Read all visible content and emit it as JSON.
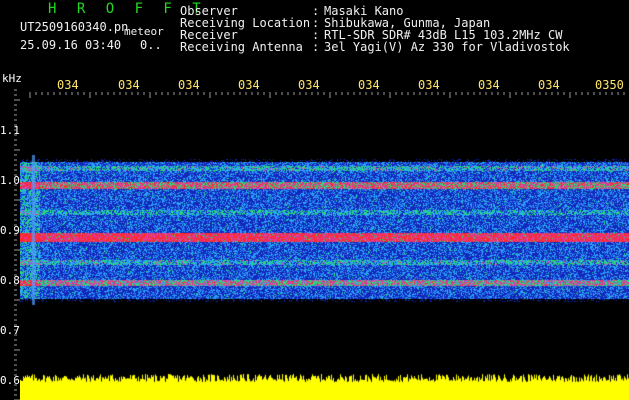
{
  "header": {
    "title": "H R O F F T",
    "filename": "UT2509160340.pn",
    "mode": "meteor",
    "datetime": "25.09.16 03:40",
    "extra": "0..",
    "meta": [
      {
        "key": "Observer",
        "value": "Masaki Kano"
      },
      {
        "key": "Receiving Location",
        "value": "Shibukawa, Gunma, Japan"
      },
      {
        "key": "Receiver",
        "value": "RTL-SDR SDR# 43dB L15 103.2MHz CW"
      },
      {
        "key": "Receiving Antenna",
        "value": "3el Yagi(V) Az 330 for Vladivostok"
      }
    ]
  },
  "axis": {
    "unit": "kHz",
    "y_labels": [
      "1.1",
      "1.0",
      "0.9",
      "0.8",
      "0.7",
      "0.6"
    ],
    "time_labels": [
      "034",
      "034",
      "034",
      "034",
      "034",
      "034",
      "034",
      "034",
      "034",
      "0350"
    ]
  },
  "colors": {
    "title_green": "#24d824",
    "time_yellow": "#ffe66a",
    "background": "#000000",
    "noise_blue": "#1a2a9a",
    "signal_red": "#ff2828",
    "power_yellow": "#ffff00"
  }
}
